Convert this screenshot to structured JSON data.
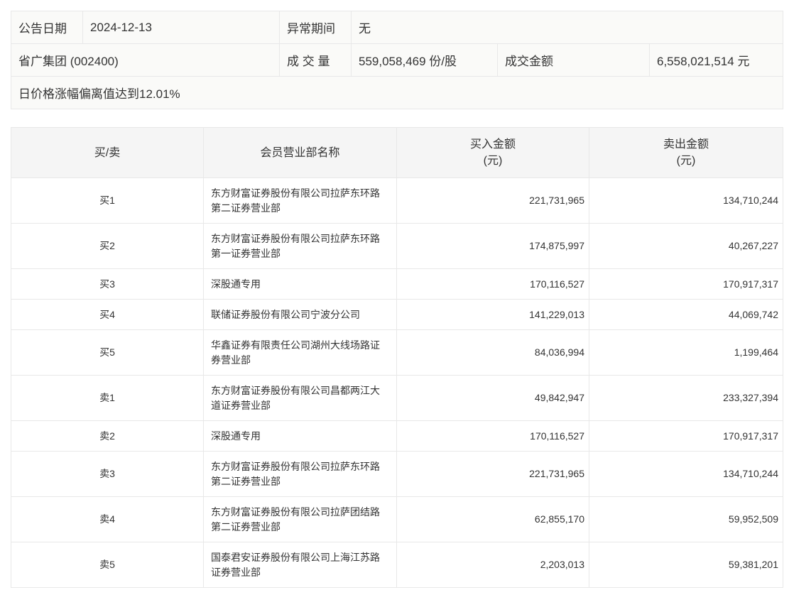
{
  "info": {
    "date_label": "公告日期",
    "date_value": "2024-12-13",
    "period_label": "异常期间",
    "period_value": "无",
    "stock": "省广集团 (002400)",
    "volume_label": "成 交 量",
    "volume_value": "559,058,469 份/股",
    "amount_label": "成交金额",
    "amount_value": "6,558,021,514 元",
    "reason": "日价格涨幅偏离值达到12.01%"
  },
  "table": {
    "headers": {
      "side": "买/卖",
      "broker": "会员营业部名称",
      "buy_line1": "买入金额",
      "buy_line2": "(元)",
      "sell_line1": "卖出金额",
      "sell_line2": "(元)"
    },
    "rows": [
      {
        "side": "买1",
        "broker_line1": "东方财富证券股份有限公司拉萨东环路",
        "broker_line2": "第二证券营业部",
        "buy": "221,731,965",
        "sell": "134,710,244"
      },
      {
        "side": "买2",
        "broker_line1": "东方财富证券股份有限公司拉萨东环路",
        "broker_line2": "第一证券营业部",
        "buy": "174,875,997",
        "sell": "40,267,227"
      },
      {
        "side": "买3",
        "broker_line1": "深股通专用",
        "broker_line2": "",
        "buy": "170,116,527",
        "sell": "170,917,317"
      },
      {
        "side": "买4",
        "broker_line1": "联储证券股份有限公司宁波分公司",
        "broker_line2": "",
        "buy": "141,229,013",
        "sell": "44,069,742"
      },
      {
        "side": "买5",
        "broker_line1": "华鑫证券有限责任公司湖州大线场路证",
        "broker_line2": "券营业部",
        "buy": "84,036,994",
        "sell": "1,199,464"
      },
      {
        "side": "卖1",
        "broker_line1": "东方财富证券股份有限公司昌都两江大",
        "broker_line2": "道证券营业部",
        "buy": "49,842,947",
        "sell": "233,327,394"
      },
      {
        "side": "卖2",
        "broker_line1": "深股通专用",
        "broker_line2": "",
        "buy": "170,116,527",
        "sell": "170,917,317"
      },
      {
        "side": "卖3",
        "broker_line1": "东方财富证券股份有限公司拉萨东环路",
        "broker_line2": "第二证券营业部",
        "buy": "221,731,965",
        "sell": "134,710,244"
      },
      {
        "side": "卖4",
        "broker_line1": "东方财富证券股份有限公司拉萨团结路",
        "broker_line2": "第二证券营业部",
        "buy": "62,855,170",
        "sell": "59,952,509"
      },
      {
        "side": "卖5",
        "broker_line1": "国泰君安证券股份有限公司上海江苏路",
        "broker_line2": "证券营业部",
        "buy": "2,203,013",
        "sell": "59,381,201"
      }
    ]
  }
}
